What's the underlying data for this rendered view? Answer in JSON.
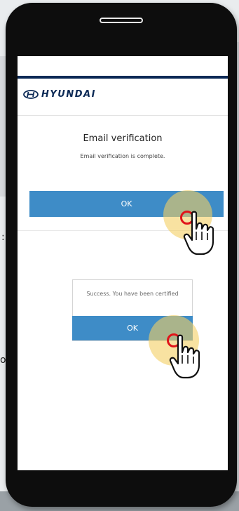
{
  "background": {
    "partial_chars": [
      ":",
      "or"
    ]
  },
  "app": {
    "brand": "HYUNDAI",
    "brand_color": "#0c2a56",
    "accent_color": "#3e8cc7"
  },
  "verification_page": {
    "title": "Email verification",
    "message": "Email verification is complete.",
    "ok_label": "OK"
  },
  "alert_dialog": {
    "message": "Success. You have been certified",
    "ok_label": "OK"
  },
  "icons": [
    "hyundai-logo-icon",
    "hand-pointer-icon",
    "tap-indicator-icon"
  ]
}
